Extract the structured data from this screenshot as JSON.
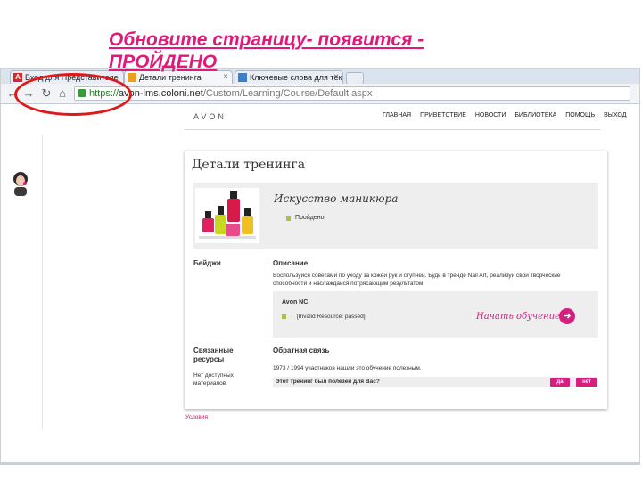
{
  "annotation": {
    "title": "Обновите страницу- появится - ПРОЙДЕНО"
  },
  "browser": {
    "tabs": [
      {
        "label": "Вход для Представителе"
      },
      {
        "label": "Детали тренинга"
      },
      {
        "label": "Ключевые слова для тек"
      }
    ],
    "url": {
      "scheme": "https://",
      "host": "avon-lms.coloni.net",
      "path": "/Custom/Learning/Course/Default.aspx"
    }
  },
  "site": {
    "logo": "AVON",
    "nav": [
      "ГЛАВНАЯ",
      "ПРИВЕТСТВИЕ",
      "НОВОСТИ",
      "БИБЛИОТЕКА",
      "ПОМОЩЬ",
      "ВЫХОД"
    ],
    "page_heading": "Детали тренинга",
    "course": {
      "title": "Искусство маникюра",
      "status": "Пройдено"
    },
    "badges_label": "Бейджи",
    "description": {
      "label": "Описание",
      "text": "Воспользуйся советами по уходу за кожей рук и ступней. Будь в тренде Nail Art, реализуй свои творческие способности и наслаждайся потрясающим результатом!"
    },
    "module": {
      "title": "Avon NC",
      "item": "[Invalid Resource: passed]",
      "start_label": "Начать обучение"
    },
    "related": {
      "label": "Связанные ресурсы",
      "empty": "Нет доступных материалов"
    },
    "feedback": {
      "label": "Обратная связь",
      "stats": "1973 / 1994 участников нашли это обучение полезным.",
      "question": "Этот тренинг был полезен для Вас?",
      "yes": "да",
      "no": "нет"
    },
    "footer_link": "Условия"
  },
  "colors": {
    "accent": "#d62080",
    "annotation_title": "#e0197a",
    "annotation_circle": "#e01818",
    "status_ok": "#a8c43a"
  },
  "icons": [
    "back-arrow-icon",
    "forward-arrow-icon",
    "reload-icon",
    "home-icon",
    "lock-icon",
    "close-icon",
    "arrow-right-circle-icon"
  ]
}
